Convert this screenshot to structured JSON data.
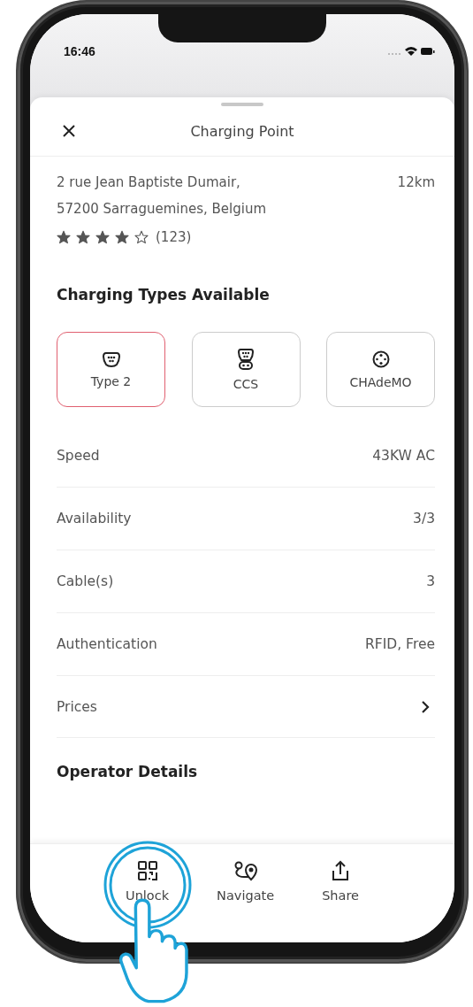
{
  "status_bar": {
    "time": "16:46"
  },
  "sheet": {
    "title": "Charging Point"
  },
  "location": {
    "address_lines": [
      "2 rue Jean Baptiste Dumair,",
      "57200 Sarraguemines, Belgium"
    ],
    "distance": "12km",
    "stars": 4,
    "review_count": "(123)"
  },
  "charging_types": {
    "heading": "Charging Types Available",
    "items": [
      {
        "kind": "type2",
        "label": "Type 2",
        "selected": true
      },
      {
        "kind": "ccs",
        "label": "CCS",
        "selected": false
      },
      {
        "kind": "chademo",
        "label": "CHAdeMO",
        "selected": false
      }
    ]
  },
  "details": [
    {
      "kind": "value",
      "label": "Speed",
      "value": "43KW AC"
    },
    {
      "kind": "value",
      "label": "Availability",
      "value": "3/3"
    },
    {
      "kind": "value",
      "label": "Cable(s)",
      "value": "3"
    },
    {
      "kind": "value",
      "label": "Authentication",
      "value": "RFID, Free"
    },
    {
      "kind": "link",
      "label": "Prices"
    }
  ],
  "operator": {
    "heading": "Operator Details"
  },
  "actions": [
    {
      "kind": "qr",
      "label": "Unlock",
      "highlighted": true
    },
    {
      "kind": "navigate",
      "label": "Navigate",
      "highlighted": false
    },
    {
      "kind": "share",
      "label": "Share",
      "highlighted": false
    }
  ]
}
